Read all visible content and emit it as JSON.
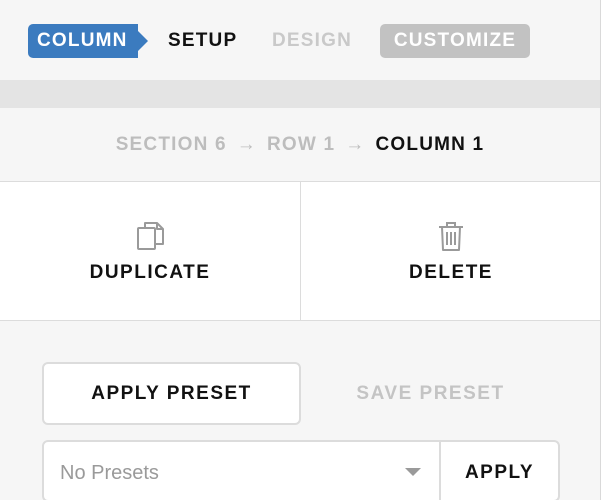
{
  "tabs": {
    "column": "COLUMN",
    "setup": "SETUP",
    "design": "DESIGN",
    "customize": "CUSTOMIZE"
  },
  "breadcrumb": {
    "items": [
      "SECTION 6",
      "ROW 1",
      "COLUMN 1"
    ],
    "separator": "→"
  },
  "actions": {
    "duplicate": {
      "label": "DUPLICATE",
      "icon": "copy-icon"
    },
    "delete": {
      "label": "DELETE",
      "icon": "trash-icon"
    }
  },
  "presets": {
    "apply_preset_label": "APPLY PRESET",
    "save_preset_label": "SAVE PRESET",
    "select_value": "No Presets",
    "apply_label": "APPLY"
  },
  "colors": {
    "accent": "#3b7bbf",
    "customize_bg": "#c2c2c2",
    "muted_text": "#bdbdbd"
  }
}
